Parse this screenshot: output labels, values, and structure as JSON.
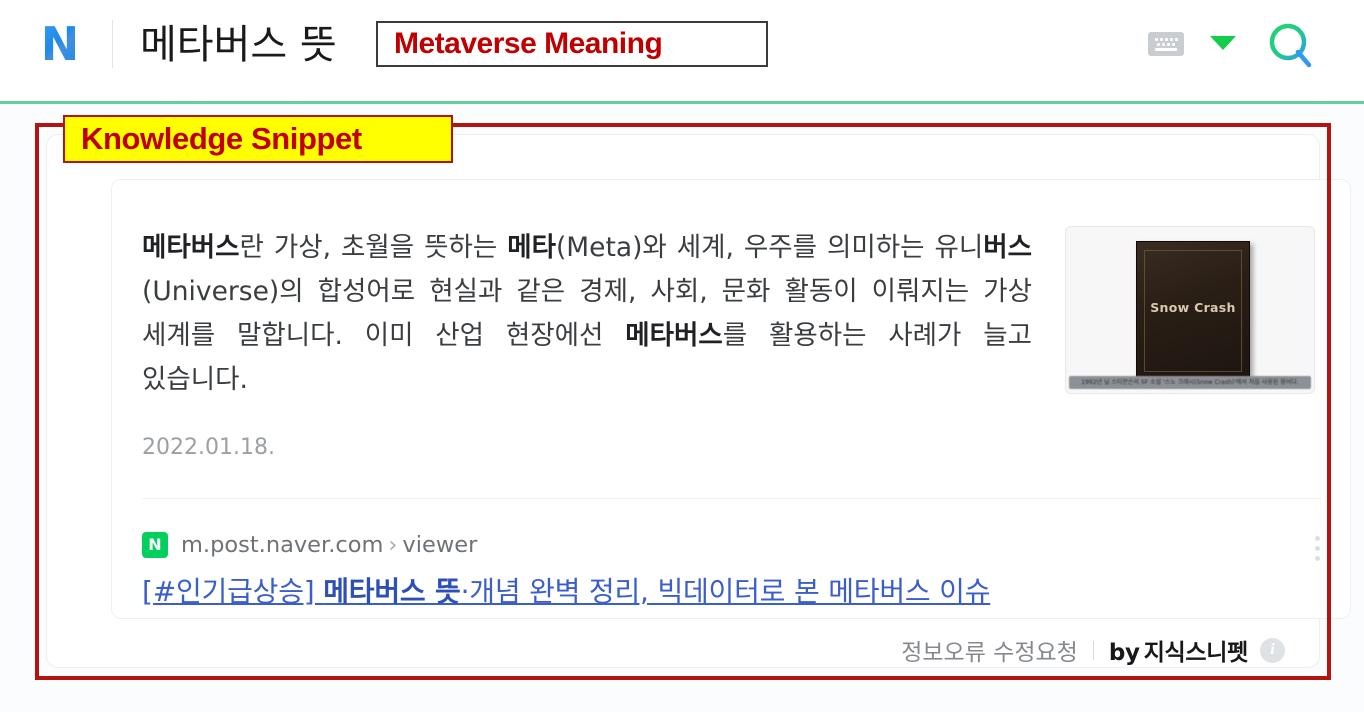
{
  "header": {
    "logo_text": "N",
    "logo_name": "naver-logo",
    "query": "메타버스 뜻",
    "annotation_label": "Metaverse Meaning",
    "keyboard_icon": "keyboard-icon",
    "dropdown_icon": "chevron-down-icon",
    "search_icon": "search-icon",
    "accent_green": "#62d09c"
  },
  "annotations": {
    "snippet_label": "Knowledge Snippet",
    "box_color": "#b51212",
    "highlight_bg": "#ffff00",
    "highlight_text_color": "#c00000"
  },
  "snippet": {
    "description_parts": [
      {
        "text": "메타버스",
        "bold": true
      },
      {
        "text": "란 가상, 초월을 뜻하는 ",
        "bold": false
      },
      {
        "text": "메타",
        "bold": true
      },
      {
        "text": "(Meta)와 세계, 우주를 의미하는 유니",
        "bold": false
      },
      {
        "text": "버스",
        "bold": true
      },
      {
        "text": "(Universe)의 합성어로 현실과 같은 경제, 사회, 문화 활동이 이뤄지는 가상 세계를 말합니다. 이미 산업 현장에선 ",
        "bold": false
      },
      {
        "text": "메타버스",
        "bold": true
      },
      {
        "text": "를 활용하는 사례가 늘고 있습니다.",
        "bold": false
      }
    ],
    "date": "2022.01.18.",
    "thumbnail": {
      "name": "snow-crash-book-thumbnail",
      "book_title": "Snow Crash",
      "caption": "1992년 닐 스티븐슨의 SF 소설 '스노 크래시(Snow Crash)'에서 처음 사용된 용어다."
    },
    "source": {
      "favicon_letter": "N",
      "favicon_color": "#03cf5d",
      "url_domain": "m.post.naver.com",
      "url_separator": "›",
      "url_path": "viewer",
      "title_parts": [
        {
          "text": "[#인기급상승] ",
          "bold": false
        },
        {
          "text": "메타버스 뜻",
          "bold": true
        },
        {
          "text": "·개념 완벽 정리, 빅데이터로 본 메타버스 이슈",
          "bold": false
        }
      ],
      "more_icon": "kebab-menu-icon"
    },
    "footer": {
      "report_label": "정보오류 수정요청",
      "by_prefix": "by",
      "brand": "지식스니펫",
      "info_icon": "info-icon",
      "info_glyph": "i"
    }
  }
}
